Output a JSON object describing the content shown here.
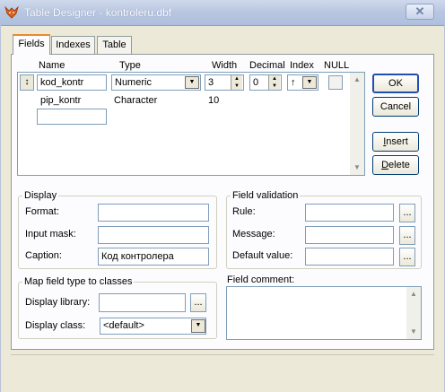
{
  "window": {
    "title": "Table Designer - kontroleru.dbf",
    "close_glyph": "✕"
  },
  "tabs": [
    {
      "label": "Fields",
      "active": true
    },
    {
      "label": "Indexes",
      "active": false
    },
    {
      "label": "Table",
      "active": false
    }
  ],
  "grid": {
    "headers": {
      "name": "Name",
      "type": "Type",
      "width": "Width",
      "decimal": "Decimal",
      "index": "Index",
      "null": "NULL"
    },
    "rows": [
      {
        "name": "kod_kontr",
        "type": "Numeric",
        "width": "3",
        "decimal": "0",
        "index": "↑"
      },
      {
        "name": "pip_kontr",
        "type": "Character",
        "width": "10",
        "decimal": "",
        "index": ""
      }
    ],
    "new_row_name": ""
  },
  "buttons": {
    "ok": "OK",
    "cancel": "Cancel",
    "insert": "Insert",
    "delete": "Delete"
  },
  "display": {
    "group_label": "Display",
    "format_label": "Format:",
    "format_value": "",
    "input_mask_label": "Input mask:",
    "input_mask_value": "",
    "caption_label": "Caption:",
    "caption_value": "Код контролера"
  },
  "map_field": {
    "group_label": "Map field type to classes",
    "display_library_label": "Display library:",
    "display_library_value": "",
    "display_class_label": "Display class:",
    "display_class_value": "<default>"
  },
  "validation": {
    "group_label": "Field validation",
    "rule_label": "Rule:",
    "rule_value": "",
    "message_label": "Message:",
    "message_value": "",
    "default_label": "Default value:",
    "default_value": "",
    "ellipsis": "..."
  },
  "comment": {
    "label": "Field comment:",
    "value": ""
  },
  "colors": {
    "accent_tab": "#e68b2c",
    "default_button_border": "#1f4fb0"
  }
}
